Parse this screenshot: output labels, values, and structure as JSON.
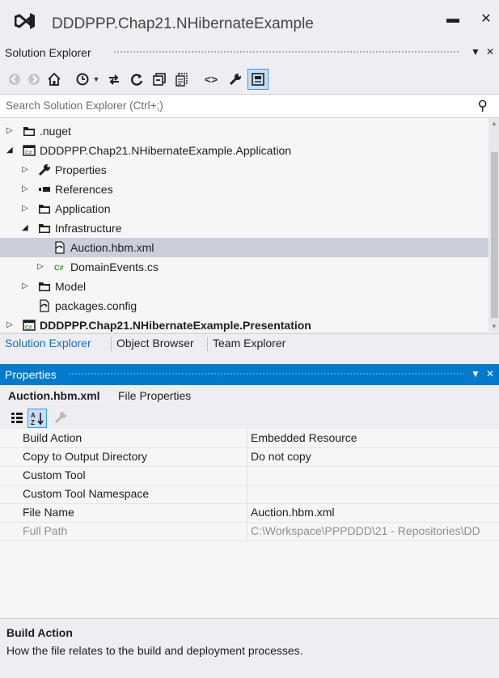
{
  "window": {
    "title": "DDDPPP.Chap21.NHibernateExample",
    "minimize_glyph": "▬",
    "close_glyph": "✕"
  },
  "solution_explorer": {
    "title": "Solution Explorer",
    "pin_glyph": "▼",
    "close_glyph": "✕",
    "toolbar_icons": [
      "back-icon",
      "forward-icon",
      "home-icon",
      "history-icon",
      "dropdown-icon",
      "sync-icon",
      "refresh-icon",
      "collapse-all-icon",
      "show-all-files-icon",
      "view-code-icon",
      "properties-icon",
      "preview-selected-icon"
    ],
    "search_placeholder": "Search Solution Explorer (Ctrl+;)",
    "tree": [
      {
        "label": ".nuget",
        "level": 0,
        "expanded": false,
        "icon": "folder-icon"
      },
      {
        "label": "DDDPPP.Chap21.NHibernateExample.Application",
        "level": 0,
        "expanded": true,
        "icon": "csharp-project-icon"
      },
      {
        "label": "Properties",
        "level": 1,
        "expanded": false,
        "icon": "wrench-icon"
      },
      {
        "label": "References",
        "level": 1,
        "expanded": false,
        "icon": "references-icon"
      },
      {
        "label": "Application",
        "level": 1,
        "expanded": false,
        "icon": "folder-icon"
      },
      {
        "label": "Infrastructure",
        "level": 1,
        "expanded": true,
        "icon": "folder-icon"
      },
      {
        "label": "Auction.hbm.xml",
        "level": 2,
        "selected": true,
        "icon": "xml-file-icon"
      },
      {
        "label": "DomainEvents.cs",
        "level": 2,
        "expanded": false,
        "icon": "csharp-file-icon"
      },
      {
        "label": "Model",
        "level": 1,
        "expanded": false,
        "icon": "folder-icon"
      },
      {
        "label": "packages.config",
        "level": 1,
        "icon": "config-file-icon"
      },
      {
        "label": "DDDPPP.Chap21.NHibernateExample.Presentation",
        "level": 0,
        "expanded": false,
        "bold": true,
        "icon": "csharp-project-icon"
      }
    ],
    "tabs": [
      "Solution Explorer",
      "Object Browser",
      "Team Explorer"
    ],
    "active_tab": "Solution Explorer"
  },
  "properties": {
    "title": "Properties",
    "object_name": "Auction.hbm.xml",
    "object_type": "File Properties",
    "rows": [
      {
        "name": "Build Action",
        "value": "Embedded Resource"
      },
      {
        "name": "Copy to Output Directory",
        "value": "Do not copy"
      },
      {
        "name": "Custom Tool",
        "value": ""
      },
      {
        "name": "Custom Tool Namespace",
        "value": ""
      },
      {
        "name": "File Name",
        "value": "Auction.hbm.xml"
      },
      {
        "name": "Full Path",
        "value": "C:\\Workspace\\PPPDDD\\21 - Repositories\\DD",
        "disabled": true
      }
    ],
    "description_title": "Build Action",
    "description_text": "How the file relates to the build and deployment processes."
  },
  "colors": {
    "accent": "#007acc",
    "selection": "#cccedb",
    "background": "#eeeef2"
  }
}
